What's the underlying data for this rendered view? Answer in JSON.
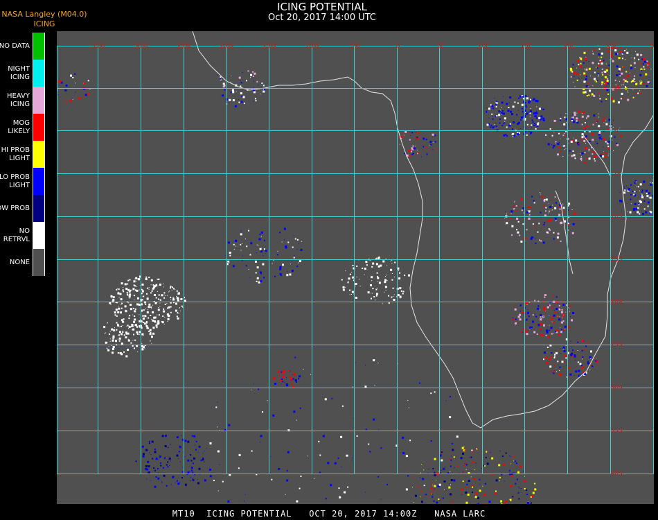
{
  "header": {
    "source": "NASA Langley (M04.0)",
    "product": "ICING",
    "title": "ICING POTENTIAL",
    "datetime": "Oct 20, 2017 14:00 UTC"
  },
  "legend": [
    {
      "label": "NO DATA",
      "color": "#00c000"
    },
    {
      "label": "NIGHT ICING",
      "color": "#00f0f0"
    },
    {
      "label": "HEAVY ICING",
      "color": "#e6a8d8"
    },
    {
      "label": "MOG LIKELY",
      "color": "#ff0000"
    },
    {
      "label": "HI PROB LIGHT",
      "color": "#ffff00"
    },
    {
      "label": "LO PROB LIGHT",
      "color": "#0000ff"
    },
    {
      "label": "LOW PROB",
      "color": "#000080"
    },
    {
      "label": "NO RETRVL",
      "color": "#ffffff"
    },
    {
      "label": "NONE",
      "color": "#505050"
    }
  ],
  "grid": {
    "color": "#3fd0d0",
    "label_color": "#c02020",
    "lon_labels": [
      "35W",
      "30W",
      "25W",
      "20W",
      "15W",
      "10W",
      "5W",
      "0",
      "5E",
      "10E",
      "15E",
      "20E",
      "25E",
      "30E",
      "35E"
    ],
    "lat_labels": [
      "5N",
      "0",
      "5S",
      "10S",
      "15S",
      "20S",
      "25S",
      "30S",
      "35S",
      "40S"
    ]
  },
  "footer": {
    "text": "MT10  ICING POTENTIAL   OCT 20, 2017 14:00Z   NASA LARC"
  }
}
